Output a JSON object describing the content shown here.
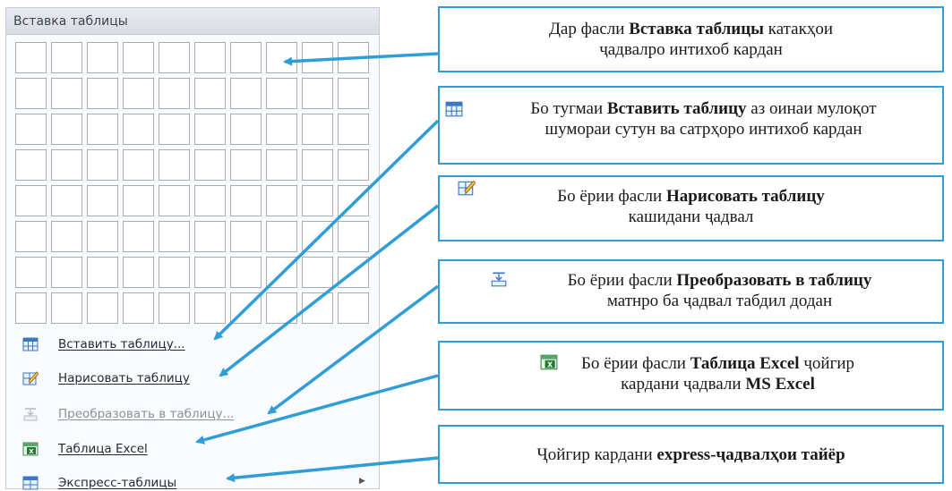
{
  "menu": {
    "header": "Вставка таблицы",
    "grid_columns": 10,
    "grid_rows": 8,
    "items": [
      {
        "label": "Вставить таблицу...",
        "icon": "insert-table-icon",
        "enabled": true
      },
      {
        "label": "Нарисовать таблицу",
        "icon": "draw-table-icon",
        "enabled": true
      },
      {
        "label": "Преобразовать в таблицу...",
        "icon": "convert-table-icon",
        "enabled": false
      },
      {
        "label": "Таблица Excel",
        "icon": "excel-table-icon",
        "enabled": true
      },
      {
        "label": "Экспресс-таблицы",
        "icon": "quick-tables-icon",
        "enabled": true,
        "submenu": true
      }
    ]
  },
  "callouts": [
    {
      "l1_pre": "Дар фасли ",
      "l1_bold": "Вставка таблицы",
      "l1_post": " катакҳои",
      "l2_pre": "ҷадвалро интихоб кардан",
      "l2_bold": "",
      "l2_post": ""
    },
    {
      "l1_pre": "Бо тугмаи ",
      "l1_bold": "Вставить таблицу",
      "l1_post": " аз оинаи мулоқот",
      "l2_pre": "шумораи сутун ва сатрҳоро интихоб кардан",
      "l2_bold": "",
      "l2_post": "",
      "icon": "insert-table-icon"
    },
    {
      "l1_pre": "Бо ёрии фасли ",
      "l1_bold": "Нарисовать таблицу",
      "l1_post": "",
      "l2_pre": "кашидани ҷадвал",
      "l2_bold": "",
      "l2_post": "",
      "icon": "draw-table-icon"
    },
    {
      "l1_pre": "Бо ёрии фасли ",
      "l1_bold": "Преобразовать в таблицу",
      "l1_post": "",
      "l2_pre": "матнро ба ҷадвал табдил додан",
      "l2_bold": "",
      "l2_post": "",
      "icon": "convert-table-icon"
    },
    {
      "l1_pre": "Бо ёрии фасли ",
      "l1_bold": "Таблица Excel",
      "l1_post": " ҷойгир",
      "l2_pre": "кардани ҷадвали ",
      "l2_bold": "MS Excel",
      "l2_post": "",
      "icon": "excel-table-icon"
    },
    {
      "l1_pre": "Ҷойгир кардани ",
      "l1_bold": "express-ҷадвалҳои тайёр",
      "l1_post": "",
      "l2_pre": "",
      "l2_bold": "",
      "l2_post": ""
    }
  ],
  "colors": {
    "arrow": "#2f9ed8",
    "callout_border": "#2f9ed8",
    "menu_header_text": "#3b4654"
  }
}
